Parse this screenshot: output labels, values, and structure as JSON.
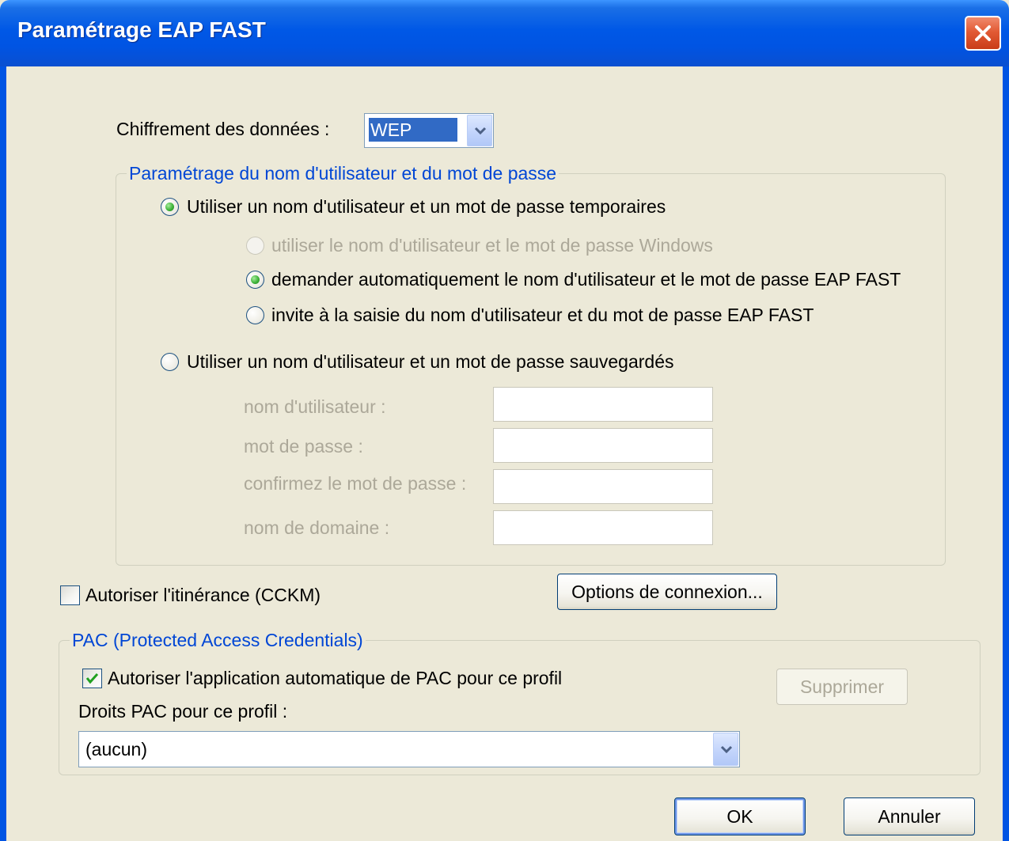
{
  "window": {
    "title": "Paramétrage EAP FAST",
    "close_icon": "close-icon",
    "frame_color": "#0054e3"
  },
  "encryption": {
    "label": "Chiffrement des données :",
    "selected": "WEP"
  },
  "credentials_group": {
    "title": "Paramétrage du nom d'utilisateur et du mot de passe",
    "temporary_radio": {
      "label": "Utiliser un nom d'utilisateur et un mot de passe temporaires",
      "checked": true
    },
    "sub_options": [
      {
        "label": "utiliser le nom d'utilisateur et le mot de passe Windows",
        "checked": false,
        "enabled": false
      },
      {
        "label": "demander automatiquement le nom d'utilisateur et le mot de passe EAP FAST",
        "checked": true,
        "enabled": true
      },
      {
        "label": "invite à la saisie du nom d'utilisateur et du mot de passe EAP FAST",
        "checked": false,
        "enabled": true
      }
    ],
    "saved_radio": {
      "label": "Utiliser un nom d'utilisateur et un mot de passe sauvegardés",
      "checked": false
    },
    "fields": [
      {
        "label": "nom d'utilisateur :",
        "value": ""
      },
      {
        "label": "mot de passe :",
        "value": ""
      },
      {
        "label": "confirmez le mot de passe :",
        "value": ""
      },
      {
        "label": "nom de domaine :",
        "value": ""
      }
    ]
  },
  "roaming": {
    "label": "Autoriser l'itinérance (CCKM)",
    "checked": false
  },
  "connection_options_button": "Options de connexion...",
  "pac_group": {
    "title": "PAC (Protected Access Credentials)",
    "auto_pac": {
      "label": "Autoriser l'application automatique de PAC pour ce profil",
      "checked": true
    },
    "delete_button": "Supprimer",
    "rights_label": "Droits PAC pour ce profil :",
    "rights_selected": "(aucun)"
  },
  "ok_button": "OK",
  "cancel_button": "Annuler",
  "colors": {
    "group_title": "#0046d5",
    "disabled_text": "#aca899",
    "dialog_background": "#ece9d8",
    "radio_check": "#3fb43a"
  }
}
